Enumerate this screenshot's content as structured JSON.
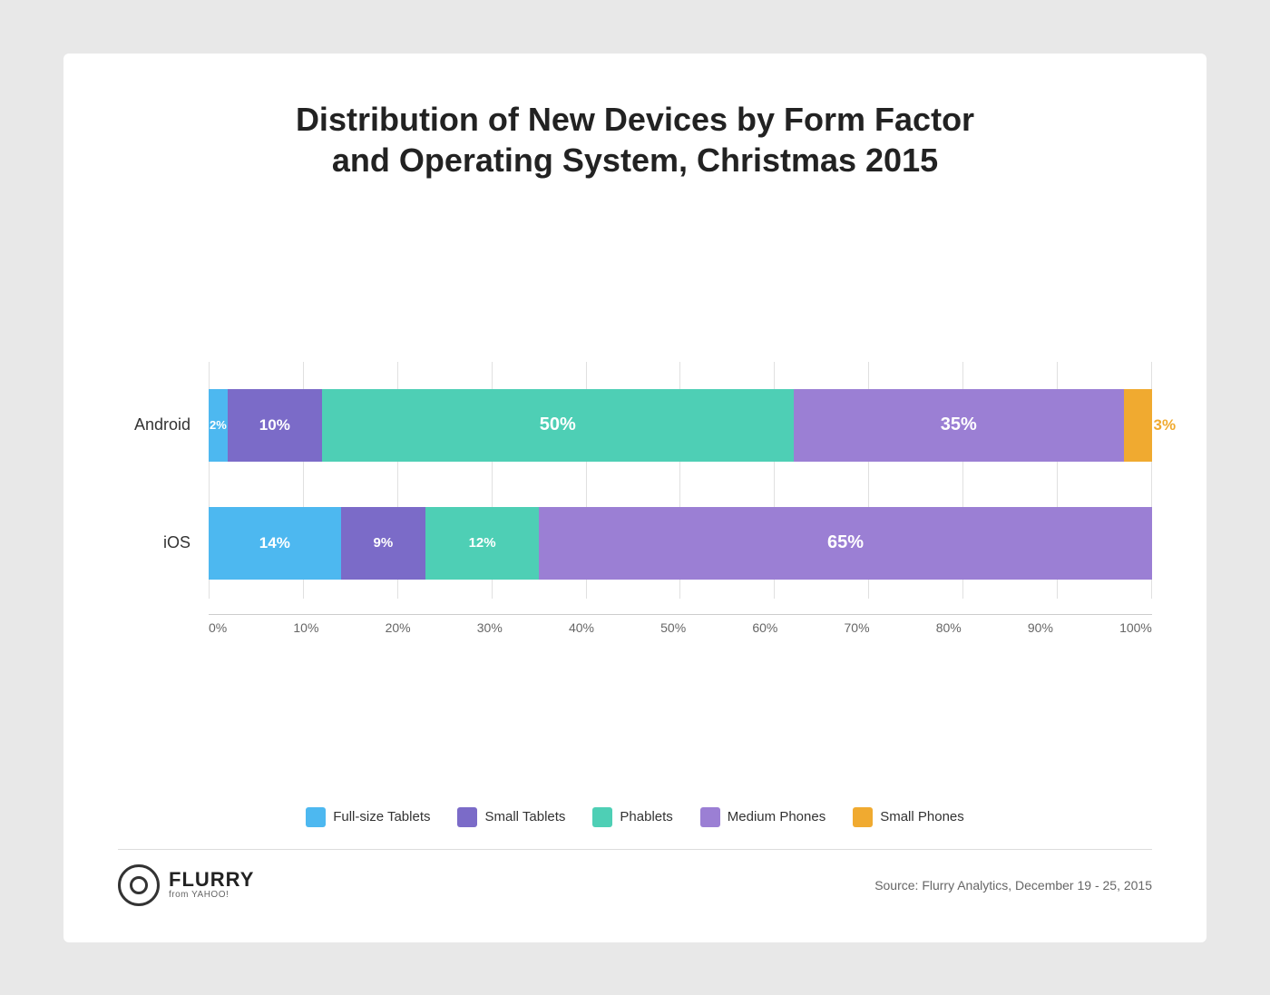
{
  "title": {
    "line1": "Distribution of New Devices by Form Factor",
    "line2": "and Operating System, Christmas 2015"
  },
  "colors": {
    "full_size_tablets": "#4db8f0",
    "small_tablets": "#7b6bc8",
    "phablets": "#4ecfb5",
    "medium_phones": "#9b7fd4",
    "small_phones": "#f0aa30"
  },
  "bars": [
    {
      "label": "Android",
      "segments": [
        {
          "key": "full_size_tablets",
          "pct": 2,
          "label": "2%",
          "color": "#4db8f0",
          "text_color": "#ffffff"
        },
        {
          "key": "small_tablets",
          "pct": 10,
          "label": "10%",
          "color": "#7b6bc8",
          "text_color": "#ffffff"
        },
        {
          "key": "phablets",
          "pct": 50,
          "label": "50%",
          "color": "#4ecfb5",
          "text_color": "#ffffff"
        },
        {
          "key": "medium_phones",
          "pct": 35,
          "label": "35%",
          "color": "#9b7fd4",
          "text_color": "#ffffff"
        },
        {
          "key": "small_phones",
          "pct": 3,
          "label": "3%",
          "color": "#f0aa30",
          "text_color": "#f0aa30",
          "outside": true
        }
      ]
    },
    {
      "label": "iOS",
      "segments": [
        {
          "key": "full_size_tablets",
          "pct": 14,
          "label": "14%",
          "color": "#4db8f0",
          "text_color": "#ffffff"
        },
        {
          "key": "small_tablets",
          "pct": 9,
          "label": "9%",
          "color": "#7b6bc8",
          "text_color": "#ffffff"
        },
        {
          "key": "phablets",
          "pct": 12,
          "label": "12%",
          "color": "#4ecfb5",
          "text_color": "#ffffff"
        },
        {
          "key": "medium_phones",
          "pct": 65,
          "label": "65%",
          "color": "#9b7fd4",
          "text_color": "#ffffff"
        }
      ]
    }
  ],
  "x_axis": {
    "labels": [
      "0%",
      "10%",
      "20%",
      "30%",
      "40%",
      "50%",
      "60%",
      "70%",
      "80%",
      "90%",
      "100%"
    ]
  },
  "legend": [
    {
      "key": "full_size_tablets",
      "label": "Full-size Tablets",
      "color": "#4db8f0"
    },
    {
      "key": "small_tablets",
      "label": "Small Tablets",
      "color": "#7b6bc8"
    },
    {
      "key": "phablets",
      "label": "Phablets",
      "color": "#4ecfb5"
    },
    {
      "key": "medium_phones",
      "label": "Medium Phones",
      "color": "#9b7fd4"
    },
    {
      "key": "small_phones",
      "label": "Small Phones",
      "color": "#f0aa30"
    }
  ],
  "footer": {
    "logo_name": "FLURRY",
    "logo_sub": "from YAHOO!",
    "source": "Source: Flurry Analytics, December 19 - 25, 2015"
  }
}
